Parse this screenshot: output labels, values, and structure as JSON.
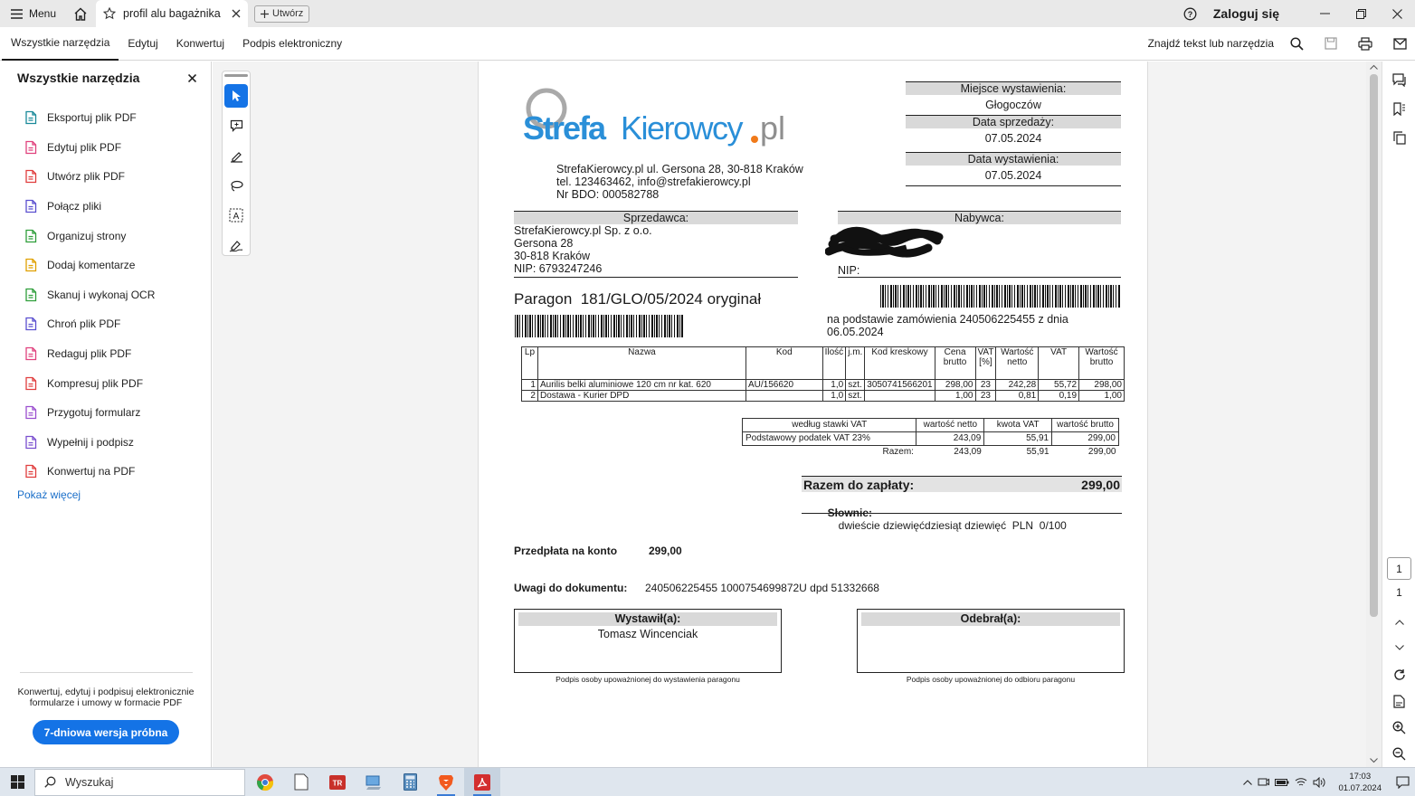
{
  "titlebar": {
    "menu_label": "Menu",
    "tab_title": "profil alu bagażnika ...",
    "new_tab_label": "Utwórz",
    "login_label": "Zaloguj się"
  },
  "menubar": {
    "items": [
      "Wszystkie narzędzia",
      "Edytuj",
      "Konwertuj",
      "Podpis elektroniczny"
    ],
    "search_label": "Znajdź tekst lub narzędzia"
  },
  "leftpanel": {
    "title": "Wszystkie narzędzia",
    "items": [
      {
        "label": "Eksportuj plik PDF",
        "icon": "export-pdf-icon",
        "color": "#1a8a9a"
      },
      {
        "label": "Edytuj plik PDF",
        "icon": "edit-pdf-icon",
        "color": "#e0417d"
      },
      {
        "label": "Utwórz plik PDF",
        "icon": "create-pdf-icon",
        "color": "#e03d3d"
      },
      {
        "label": "Połącz pliki",
        "icon": "combine-files-icon",
        "color": "#5a4fcf"
      },
      {
        "label": "Organizuj strony",
        "icon": "organize-pages-icon",
        "color": "#2e9e3a"
      },
      {
        "label": "Dodaj komentarze",
        "icon": "comment-icon",
        "color": "#e0a000"
      },
      {
        "label": "Skanuj i wykonaj OCR",
        "icon": "scan-ocr-icon",
        "color": "#2e9e3a"
      },
      {
        "label": "Chroń plik PDF",
        "icon": "protect-pdf-icon",
        "color": "#5a4fcf"
      },
      {
        "label": "Redaguj plik PDF",
        "icon": "redact-pdf-icon",
        "color": "#e0417d"
      },
      {
        "label": "Kompresuj plik PDF",
        "icon": "compress-pdf-icon",
        "color": "#e03d3d"
      },
      {
        "label": "Przygotuj formularz",
        "icon": "prepare-form-icon",
        "color": "#9b4fcf"
      },
      {
        "label": "Wypełnij i podpisz",
        "icon": "fill-sign-icon",
        "color": "#7a4fcf"
      },
      {
        "label": "Konwertuj na PDF",
        "icon": "convert-pdf-icon",
        "color": "#e03d3d"
      }
    ],
    "show_more": "Pokaż więcej",
    "promo_text": "Konwertuj, edytuj i podpisuj elektronicznie formularze i umowy w formacie PDF",
    "trial_button": "7-dniowa wersja próbna"
  },
  "document": {
    "logo_text_blue": "StrefaKierowcy",
    "logo_text_tld": ".pl",
    "company_address": "StrefaKierowcy.pl ul. Gersona 28, 30-818 Kraków",
    "company_contact": "tel. 123463462, info@strefakierowcy.pl",
    "company_bdo": "Nr BDO: 000582788",
    "place_label": "Miejsce wystawienia:",
    "place_value": "Głogoczów",
    "sale_date_label": "Data sprzedaży:",
    "sale_date_value": "07.05.2024",
    "issue_date_label": "Data wystawienia:",
    "issue_date_value": "07.05.2024",
    "seller_label": "Sprzedawca:",
    "seller_lines": [
      "StrefaKierowcy.pl Sp. z o.o.",
      "Gersona 28",
      "30-818 Kraków",
      "NIP: 6793247246"
    ],
    "buyer_label": "Nabywca:",
    "buyer_nip": "NIP:",
    "receipt_title": "Paragon  181/GLO/05/2024 oryginał",
    "order_ref": "na podstawie zamówienia 240506225455 z dnia 06.05.2024",
    "items_headers": [
      "Lp",
      "Nazwa",
      "Kod",
      "Ilość",
      "j.m.",
      "Kod kreskowy",
      "Cena brutto",
      "VAT [%]",
      "Wartość netto",
      "VAT",
      "Wartość brutto"
    ],
    "items": [
      [
        "1",
        "Aurilis belki aluminiowe 120 cm nr kat. 620",
        "AU/156620",
        "1,0",
        "szt.",
        "3050741566201",
        "298,00",
        "23",
        "242,28",
        "55,72",
        "298,00"
      ],
      [
        "2",
        "Dostawa - Kurier DPD",
        "",
        "1,0",
        "szt.",
        "",
        "1,00",
        "23",
        "0,81",
        "0,19",
        "1,00"
      ]
    ],
    "vat_headers": [
      "według stawki VAT",
      "wartość netto",
      "kwota VAT",
      "wartość brutto"
    ],
    "vat_rows": [
      [
        "Podstawowy podatek VAT 23%",
        "243,09",
        "55,91",
        "299,00"
      ]
    ],
    "vat_total": [
      "Razem:",
      "243,09",
      "55,91",
      "299,00"
    ],
    "total_label": "Razem do zapłaty:",
    "total_value": "299,00",
    "words_label": "Słownie:",
    "words_value": "dwieście dziewięćdziesiąt dziewięć  PLN  0/100",
    "prepay_label": "Przedpłata na konto",
    "prepay_value": "299,00",
    "notes_label": "Uwagi do dokumentu:",
    "notes_value": "240506225455 1000754699872U dpd 51332668",
    "issued_by_label": "Wystawił(a):",
    "issued_by_name": "Tomasz Wincenciak",
    "issued_by_caption": "Podpis osoby upoważnionej do wystawienia paragonu",
    "received_by_label": "Odebrał(a):",
    "received_by_caption": "Podpis osoby upoważnionej do odbioru paragonu"
  },
  "rightrail": {
    "current_page": "1",
    "total_pages": "1"
  },
  "taskbar": {
    "search_placeholder": "Wyszukaj",
    "time": "17:03",
    "date": "01.07.2024"
  },
  "colors": {
    "accent": "#1473e6",
    "logo_blue": "#2a8fd8",
    "logo_orange": "#f07a1a"
  }
}
